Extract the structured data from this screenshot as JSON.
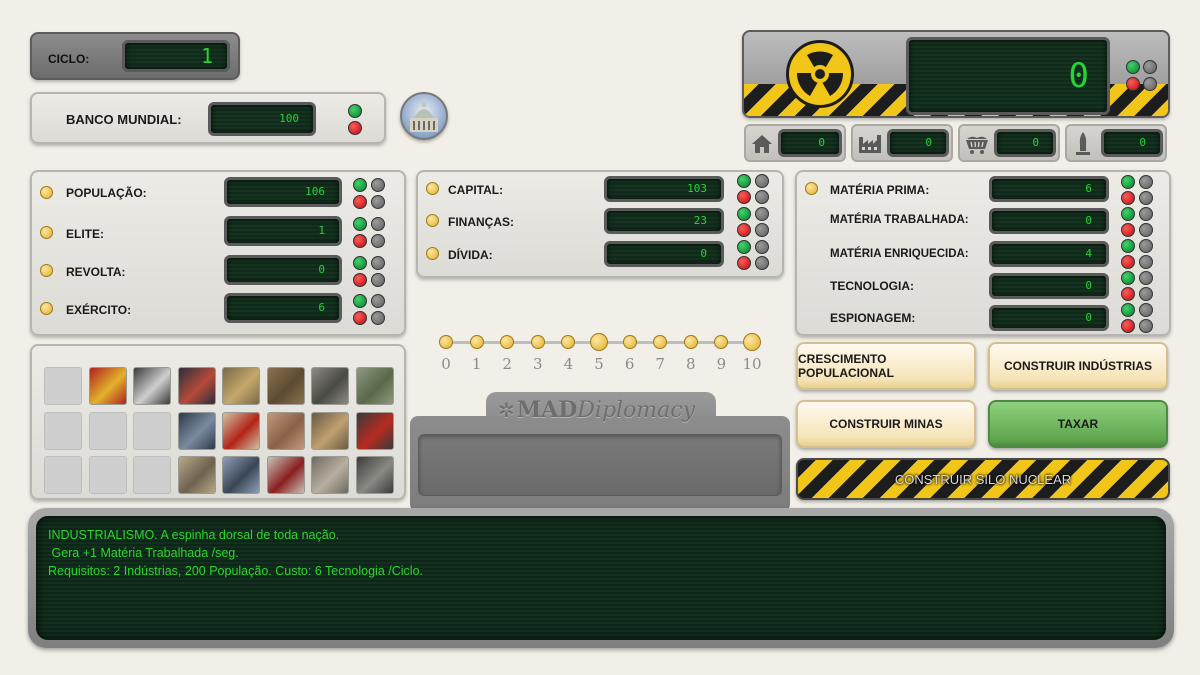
{
  "cycle": {
    "label": "CICLO:",
    "value": "1"
  },
  "world_bank": {
    "label": "BANCO MUNDIAL:",
    "value": "100"
  },
  "nuclear": {
    "value": "0",
    "counters": [
      {
        "icon": "house-icon",
        "value": "0"
      },
      {
        "icon": "factory-icon",
        "value": "0"
      },
      {
        "icon": "mine-cart-icon",
        "value": "0"
      },
      {
        "icon": "missile-icon",
        "value": "0"
      }
    ]
  },
  "stats_left": [
    {
      "label": "POPULAÇÃO:",
      "value": "106"
    },
    {
      "label": "ELITE:",
      "value": "1"
    },
    {
      "label": "REVOLTA:",
      "value": "0"
    },
    {
      "label": "EXÉRCITO:",
      "value": "6"
    }
  ],
  "stats_middle": [
    {
      "label": "CAPITAL:",
      "value": "103"
    },
    {
      "label": "FINANÇAS:",
      "value": "23"
    },
    {
      "label": "DÍVIDA:",
      "value": "0"
    }
  ],
  "stats_right": [
    {
      "label": "MATÉRIA PRIMA:",
      "value": "6"
    },
    {
      "label": "MATÉRIA TRABALHADA:",
      "value": "0"
    },
    {
      "label": "MATÉRIA ENRIQUECIDA:",
      "value": "4"
    },
    {
      "label": "TECNOLOGIA:",
      "value": "0"
    },
    {
      "label": "ESPIONAGEM:",
      "value": "0"
    }
  ],
  "slider": {
    "ticks": [
      "0",
      "1",
      "2",
      "3",
      "4",
      "5",
      "6",
      "7",
      "8",
      "9",
      "10"
    ],
    "selected": 5
  },
  "logo": {
    "bold": "MAD",
    "italic": "Diplomacy"
  },
  "actions": {
    "population_growth": "CRESCIMENTO POPULACIONAL",
    "build_industries": "CONSTRUIR INDÚSTRIAS",
    "build_mines": "CONSTRUIR MINAS",
    "tax": "TAXAR",
    "build_silo": "CONSTRUIR SILO NUCLEAR"
  },
  "cards": {
    "rows": [
      [
        "empty",
        "soviet",
        "robot",
        "stock-chart",
        "painting",
        "painting-2",
        "city-rubble",
        "forest"
      ],
      [
        "empty",
        "empty",
        "empty",
        "ship",
        "apple-books",
        "hands",
        "library",
        "red-car"
      ],
      [
        "empty",
        "empty",
        "empty",
        "square",
        "warship",
        "soldiers",
        "missiles",
        "gas-masks"
      ]
    ]
  },
  "info": {
    "line1": "INDUSTRIALISMO. A espinha dorsal de toda nação.",
    "line2": " Gera +1 Matéria Trabalhada /seg.",
    "line3": "Requisitos: 2 Indústrias, 200 População. Custo: 6 Tecnologia /Ciclo."
  },
  "colors": {
    "lcd_text": "#27d337",
    "hazard_yellow": "#f2c618",
    "tax_button": "#6bb35a",
    "terminal_text": "#2fd52f"
  }
}
